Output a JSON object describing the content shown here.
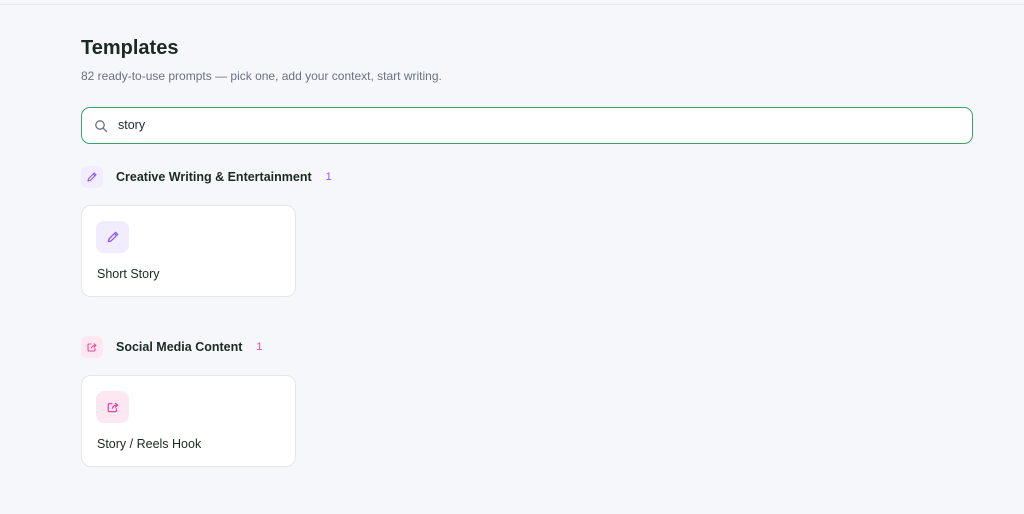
{
  "header": {
    "title": "Templates",
    "subtitle": "82 ready-to-use prompts — pick one, add your context, start writing."
  },
  "search": {
    "value": "story",
    "icon": "search-icon"
  },
  "colors": {
    "accent_green": "#3aa564",
    "creative_purple": "#8b5cf6",
    "creative_bg": "#f1ecfe",
    "social_pink": "#ec4899",
    "social_bg": "#fde8f1"
  },
  "sections": [
    {
      "title": "Creative Writing & Entertainment",
      "count": "1",
      "icon": "pencil-icon",
      "templates": [
        {
          "title": "Short Story",
          "icon": "pencil-icon"
        }
      ]
    },
    {
      "title": "Social Media Content",
      "count": "1",
      "icon": "share-icon",
      "templates": [
        {
          "title": "Story / Reels Hook",
          "icon": "share-icon"
        }
      ]
    }
  ]
}
